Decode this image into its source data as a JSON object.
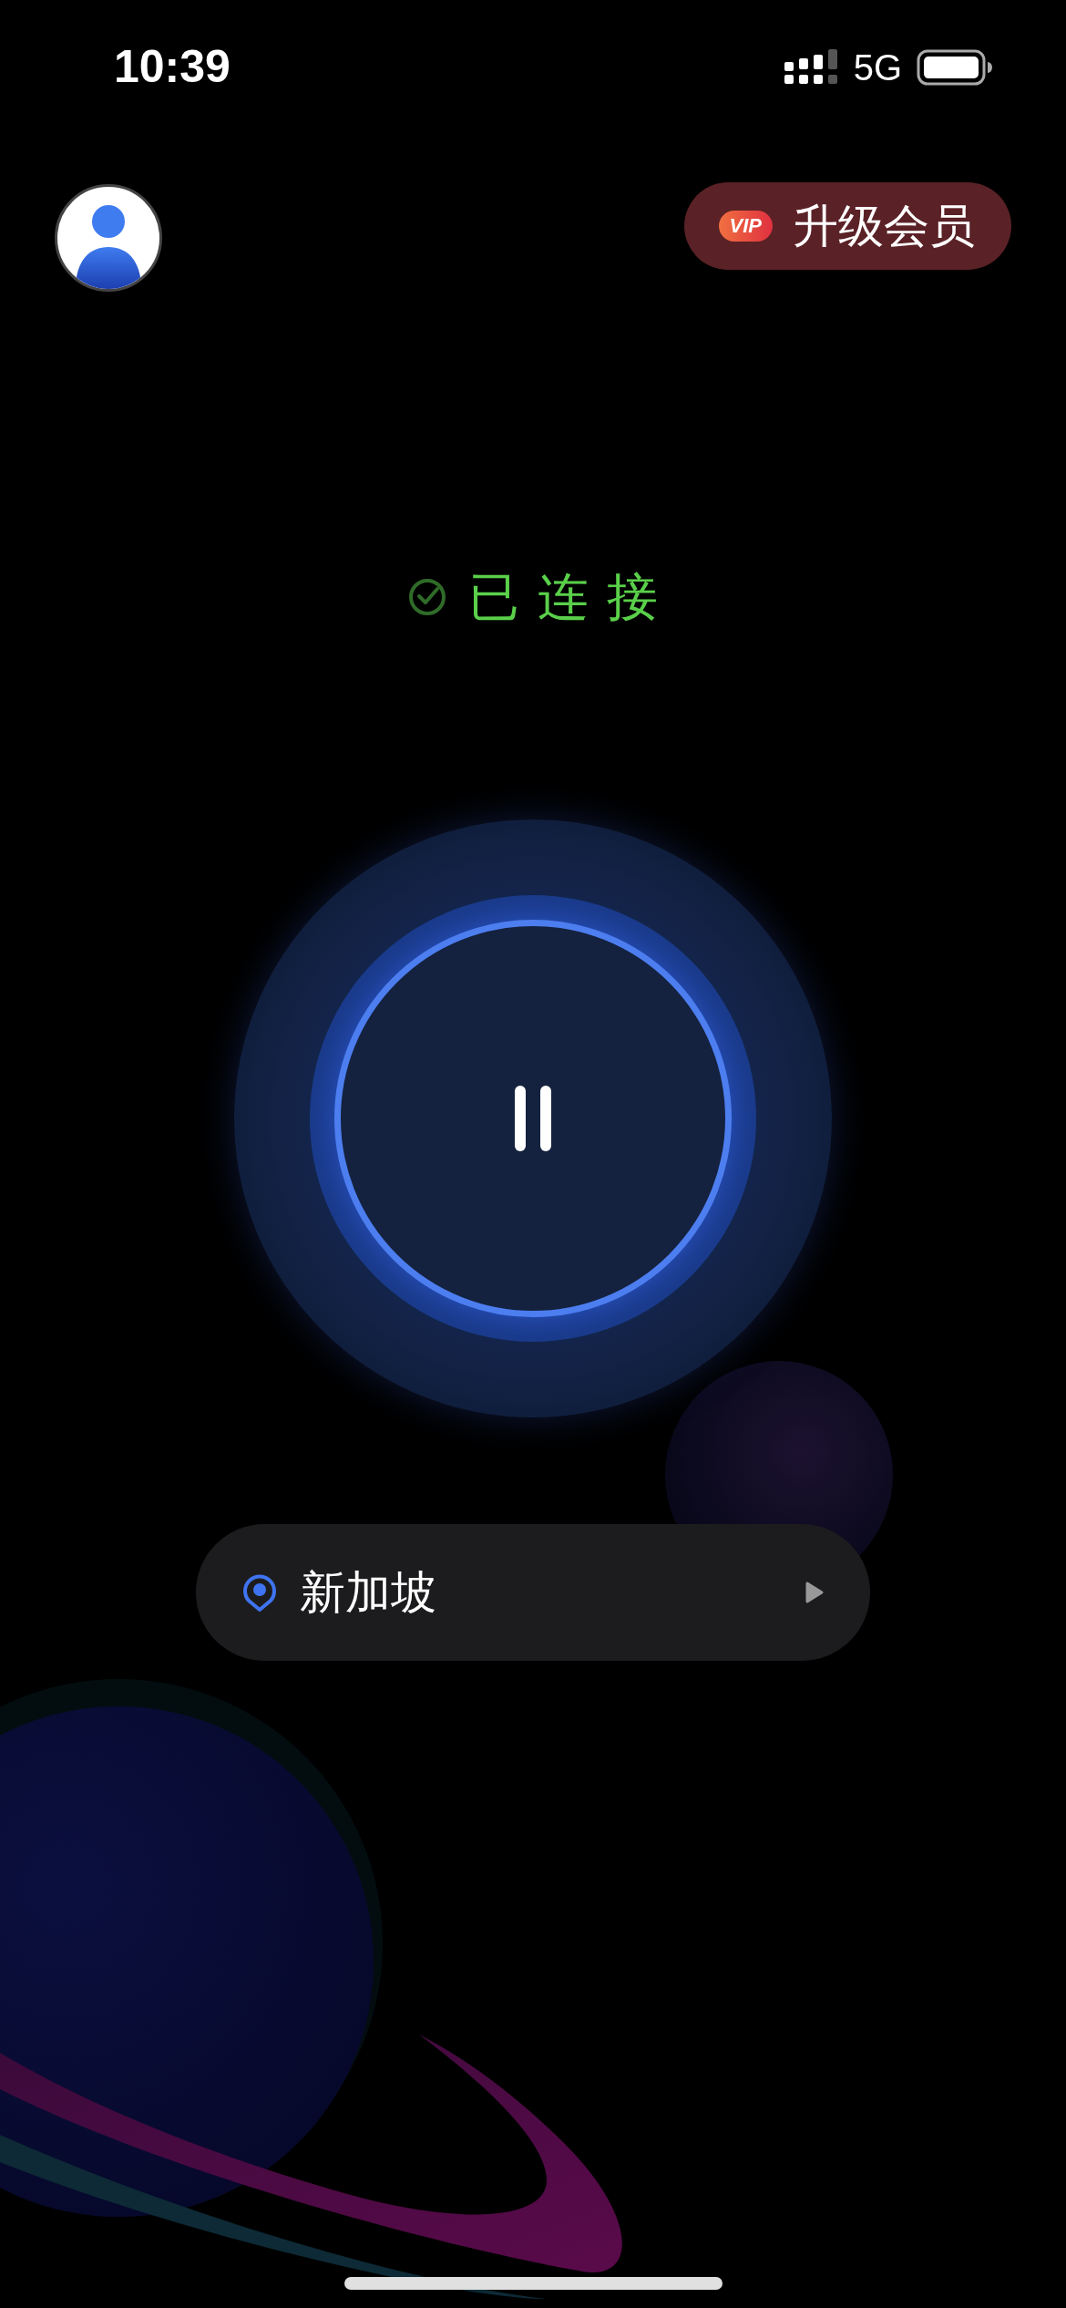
{
  "status_bar": {
    "time": "10:39",
    "network": "5G"
  },
  "header": {
    "vip_badge": "VIP",
    "upgrade_label": "升级会员"
  },
  "connection": {
    "status": "已连接",
    "connected": true
  },
  "location": {
    "name": "新加坡"
  }
}
